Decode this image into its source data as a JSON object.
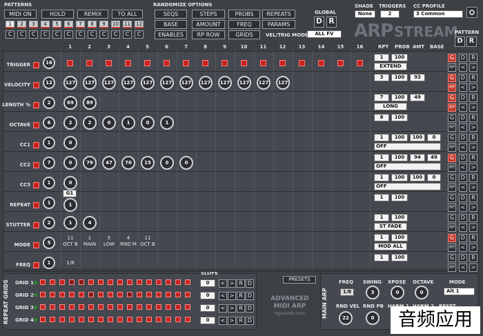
{
  "patterns": {
    "label": "PATTERNS",
    "buttons": [
      "MIDI ON",
      "HOLD",
      "REMIX",
      "TO ALL"
    ],
    "numbers": [
      "1",
      "2",
      "3",
      "4",
      "5",
      "6",
      "7",
      "8",
      "9",
      "10",
      "11",
      "12"
    ],
    "c": "C"
  },
  "randomize": {
    "label": "RANDOMIZE OPTIONS",
    "buttons": [
      "SEQS",
      "STEPS",
      "PROBS",
      "REPEATS",
      "BASE",
      "AMOUNT",
      "FREQ",
      "PARAMS",
      "ENABLES",
      "RP ROW",
      "GRIDS"
    ],
    "vel_trig_label": "VEL/TRIG MODE",
    "vel_trig_value": "ALL FV"
  },
  "global": {
    "label": "GLOBAL",
    "d": "D",
    "r": "R"
  },
  "shade": {
    "label": "SHADE",
    "value": "None"
  },
  "triggers": {
    "label": "TRIGGERS",
    "value": "2"
  },
  "cc_profile": {
    "label": "CC PROFILE",
    "value": "3 Common"
  },
  "logo": {
    "arp": "ARP",
    "stream": "STREAM"
  },
  "pattern": {
    "label": "PATTERN",
    "d": "D",
    "r": "R"
  },
  "columns": [
    "1",
    "2",
    "3",
    "4",
    "5",
    "6",
    "7",
    "8",
    "9",
    "10",
    "11",
    "12",
    "13",
    "14",
    "15",
    "16"
  ],
  "right_headers": [
    "RPT",
    "PROB",
    "AMT",
    "BASE"
  ],
  "rows": [
    {
      "name": "TRIGGER",
      "knob": "16",
      "rpt": "1",
      "prob": "100",
      "amt": "",
      "base": "",
      "mode": "EXTEND"
    },
    {
      "name": "VELOCITY",
      "knob": "12",
      "rpt": "3",
      "prob": "100",
      "amt": "93",
      "base": ""
    },
    {
      "name": "LENGTH %",
      "knob": "2",
      "rpt": "7",
      "prob": "100",
      "amt": "49",
      "base": "",
      "mode": "LONG"
    },
    {
      "name": "OCTAVE",
      "knob": "6",
      "rpt": "8",
      "prob": "100",
      "amt": "",
      "base": ""
    },
    {
      "name": "CC1",
      "knob": "1",
      "rpt": "1",
      "prob": "100",
      "amt": "100",
      "base": "0",
      "mode": "OFF"
    },
    {
      "name": "CC2",
      "knob": "7",
      "rpt": "1",
      "prob": "100",
      "amt": "94",
      "base": "49",
      "mode": "OFF"
    },
    {
      "name": "CC3",
      "knob": "1",
      "rpt": "1",
      "prob": "100",
      "amt": "100",
      "base": "0",
      "mode": "OFF"
    },
    {
      "name": "REPEAT",
      "knob": "1",
      "rpt": "1",
      "prob": "100",
      "amt": "",
      "base": ""
    },
    {
      "name": "STUTTER",
      "knob": "2",
      "rpt": "1",
      "prob": "100",
      "amt": "",
      "base": "",
      "mode": "ST FADE"
    },
    {
      "name": "MODE",
      "knob": "5",
      "rpt": "1",
      "prob": "100",
      "amt": "",
      "base": "",
      "mode": "MOD ALL"
    },
    {
      "name": "FREQ",
      "knob": "1",
      "rpt": "1",
      "prob": "100",
      "amt": "",
      "base": ""
    }
  ],
  "velocity_vals": [
    "127",
    "127",
    "127",
    "127",
    "127",
    "127",
    "127",
    "127",
    "127",
    "127",
    "127",
    "127"
  ],
  "length_vals": [
    "69",
    "89"
  ],
  "octave_vals": [
    "2",
    "2",
    "0",
    "1",
    "0",
    "1"
  ],
  "cc1_vals": [
    "0"
  ],
  "cc2_vals": [
    "0",
    "79",
    "47",
    "70",
    "15",
    "0",
    "0"
  ],
  "cc3_vals": [
    "0"
  ],
  "repeat": {
    "g": "G1",
    "val": "1"
  },
  "stutter_vals": [
    "1",
    "4"
  ],
  "mode_vals": [
    {
      "n": "11",
      "t": "OCT B"
    },
    {
      "n": "1",
      "t": "MAIN"
    },
    {
      "n": "5",
      "t": "LOW"
    },
    {
      "n": "4",
      "t": "RND M"
    },
    {
      "n": "11",
      "t": "OCT B"
    }
  ],
  "freq_vals": [
    "1/8"
  ],
  "side_buttons": {
    "g": "G",
    "d": "D",
    "r": "R",
    "rp": "RP",
    "lt": "<",
    "gt": ">"
  },
  "repeat_grids": {
    "label": "REPEAT GRIDS",
    "slope": "SLOPE",
    "grids": [
      {
        "name": "GRID 1",
        "slope": "0"
      },
      {
        "name": "GRID 2",
        "slope": "0"
      },
      {
        "name": "GRID 3",
        "slope": "0"
      },
      {
        "name": "GRID 4",
        "slope": "0"
      }
    ],
    "lt": "<",
    "gt": ">",
    "r": "R",
    "d": "D"
  },
  "presets": "PRESETS",
  "adv": {
    "l1": "ADVANCED",
    "l2": "MIDI ARP",
    "l3": "hgsounds.com"
  },
  "main_arp": {
    "label": "MAIN ARP",
    "freq_label": "FREQ",
    "freq": "1/8",
    "swing_label": "SWING",
    "swing": "3",
    "xpose_label": "XPOSE",
    "xpose": "0",
    "octave_label": "OCTAVE",
    "octave": "0",
    "mode_label": "MODE",
    "mode": "Alt 1",
    "rndvel_label": "RND VEL",
    "rndvel": "22",
    "rndpb_label": "RND PB",
    "rndpb": "0",
    "harm1": "HARM 1",
    "harm2": "HARM 2",
    "reset": "RESET"
  },
  "watermark": "音频应用"
}
